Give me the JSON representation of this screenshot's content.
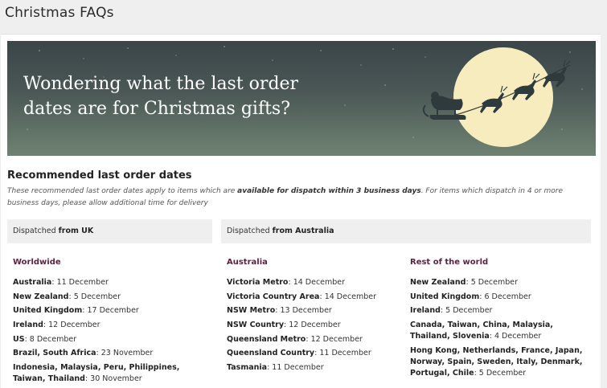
{
  "page": {
    "title": "Christmas FAQs"
  },
  "hero": {
    "line1": "Wondering what the last order",
    "line2": "dates are for Christmas gifts?"
  },
  "section": {
    "heading": "Recommended last order dates",
    "intro_pre": "These recommended last order dates apply to items which are ",
    "intro_bold": "available for dispatch within 3 business days",
    "intro_post": ". For items which dispatch in 4 or more business days, please allow additional time for delivery"
  },
  "dispatch": {
    "uk_prefix": "Dispatched ",
    "uk_bold": "from UK",
    "au_prefix": "Dispatched ",
    "au_bold": "from Australia"
  },
  "columns": {
    "worldwide": {
      "heading": "Worldwide",
      "entries": [
        {
          "place": "Australia",
          "date": "11 December"
        },
        {
          "place": "New Zealand",
          "date": "5 December"
        },
        {
          "place": "United Kingdom",
          "date": "17 December"
        },
        {
          "place": "Ireland",
          "date": "12 December"
        },
        {
          "place": "US",
          "date": "8 December"
        },
        {
          "place": "Brazil, South Africa",
          "date": "23 November"
        },
        {
          "place": "Indonesia, Malaysia, Peru, Philippines, Taiwan, Thailand",
          "date": "30 November"
        }
      ]
    },
    "australia": {
      "heading": "Australia",
      "entries": [
        {
          "place": "Victoria Metro",
          "date": "14 December"
        },
        {
          "place": "Victoria Country Area",
          "date": "14 December"
        },
        {
          "place": "NSW Metro",
          "date": "13 December"
        },
        {
          "place": "NSW Country",
          "date": "12 December"
        },
        {
          "place": "Queensland Metro",
          "date": "12 December"
        },
        {
          "place": "Queensland Country",
          "date": "11 December"
        },
        {
          "place": "Tasmania",
          "date": "11 December"
        }
      ]
    },
    "rest": {
      "heading": "Rest of the world",
      "entries": [
        {
          "place": "New Zealand",
          "date": "5 December"
        },
        {
          "place": "United Kingdom",
          "date": "6 December"
        },
        {
          "place": "Ireland",
          "date": "5 December"
        },
        {
          "place": "Canada, Taiwan, China, Malaysia, Thailand, Slovenia",
          "date": "4 December"
        },
        {
          "place": "Hong Kong, Netherlands, France, Japan, Norway, Spain, Sweden, Italy, Denmark, Portugal, Chile",
          "date": "5 December"
        }
      ]
    }
  },
  "colors": {
    "accent": "#5a2341",
    "moon": "#f3e7b5",
    "panel": "#efefef"
  },
  "icons": {
    "hero_art": "santa-sleigh-reindeer-moon"
  }
}
